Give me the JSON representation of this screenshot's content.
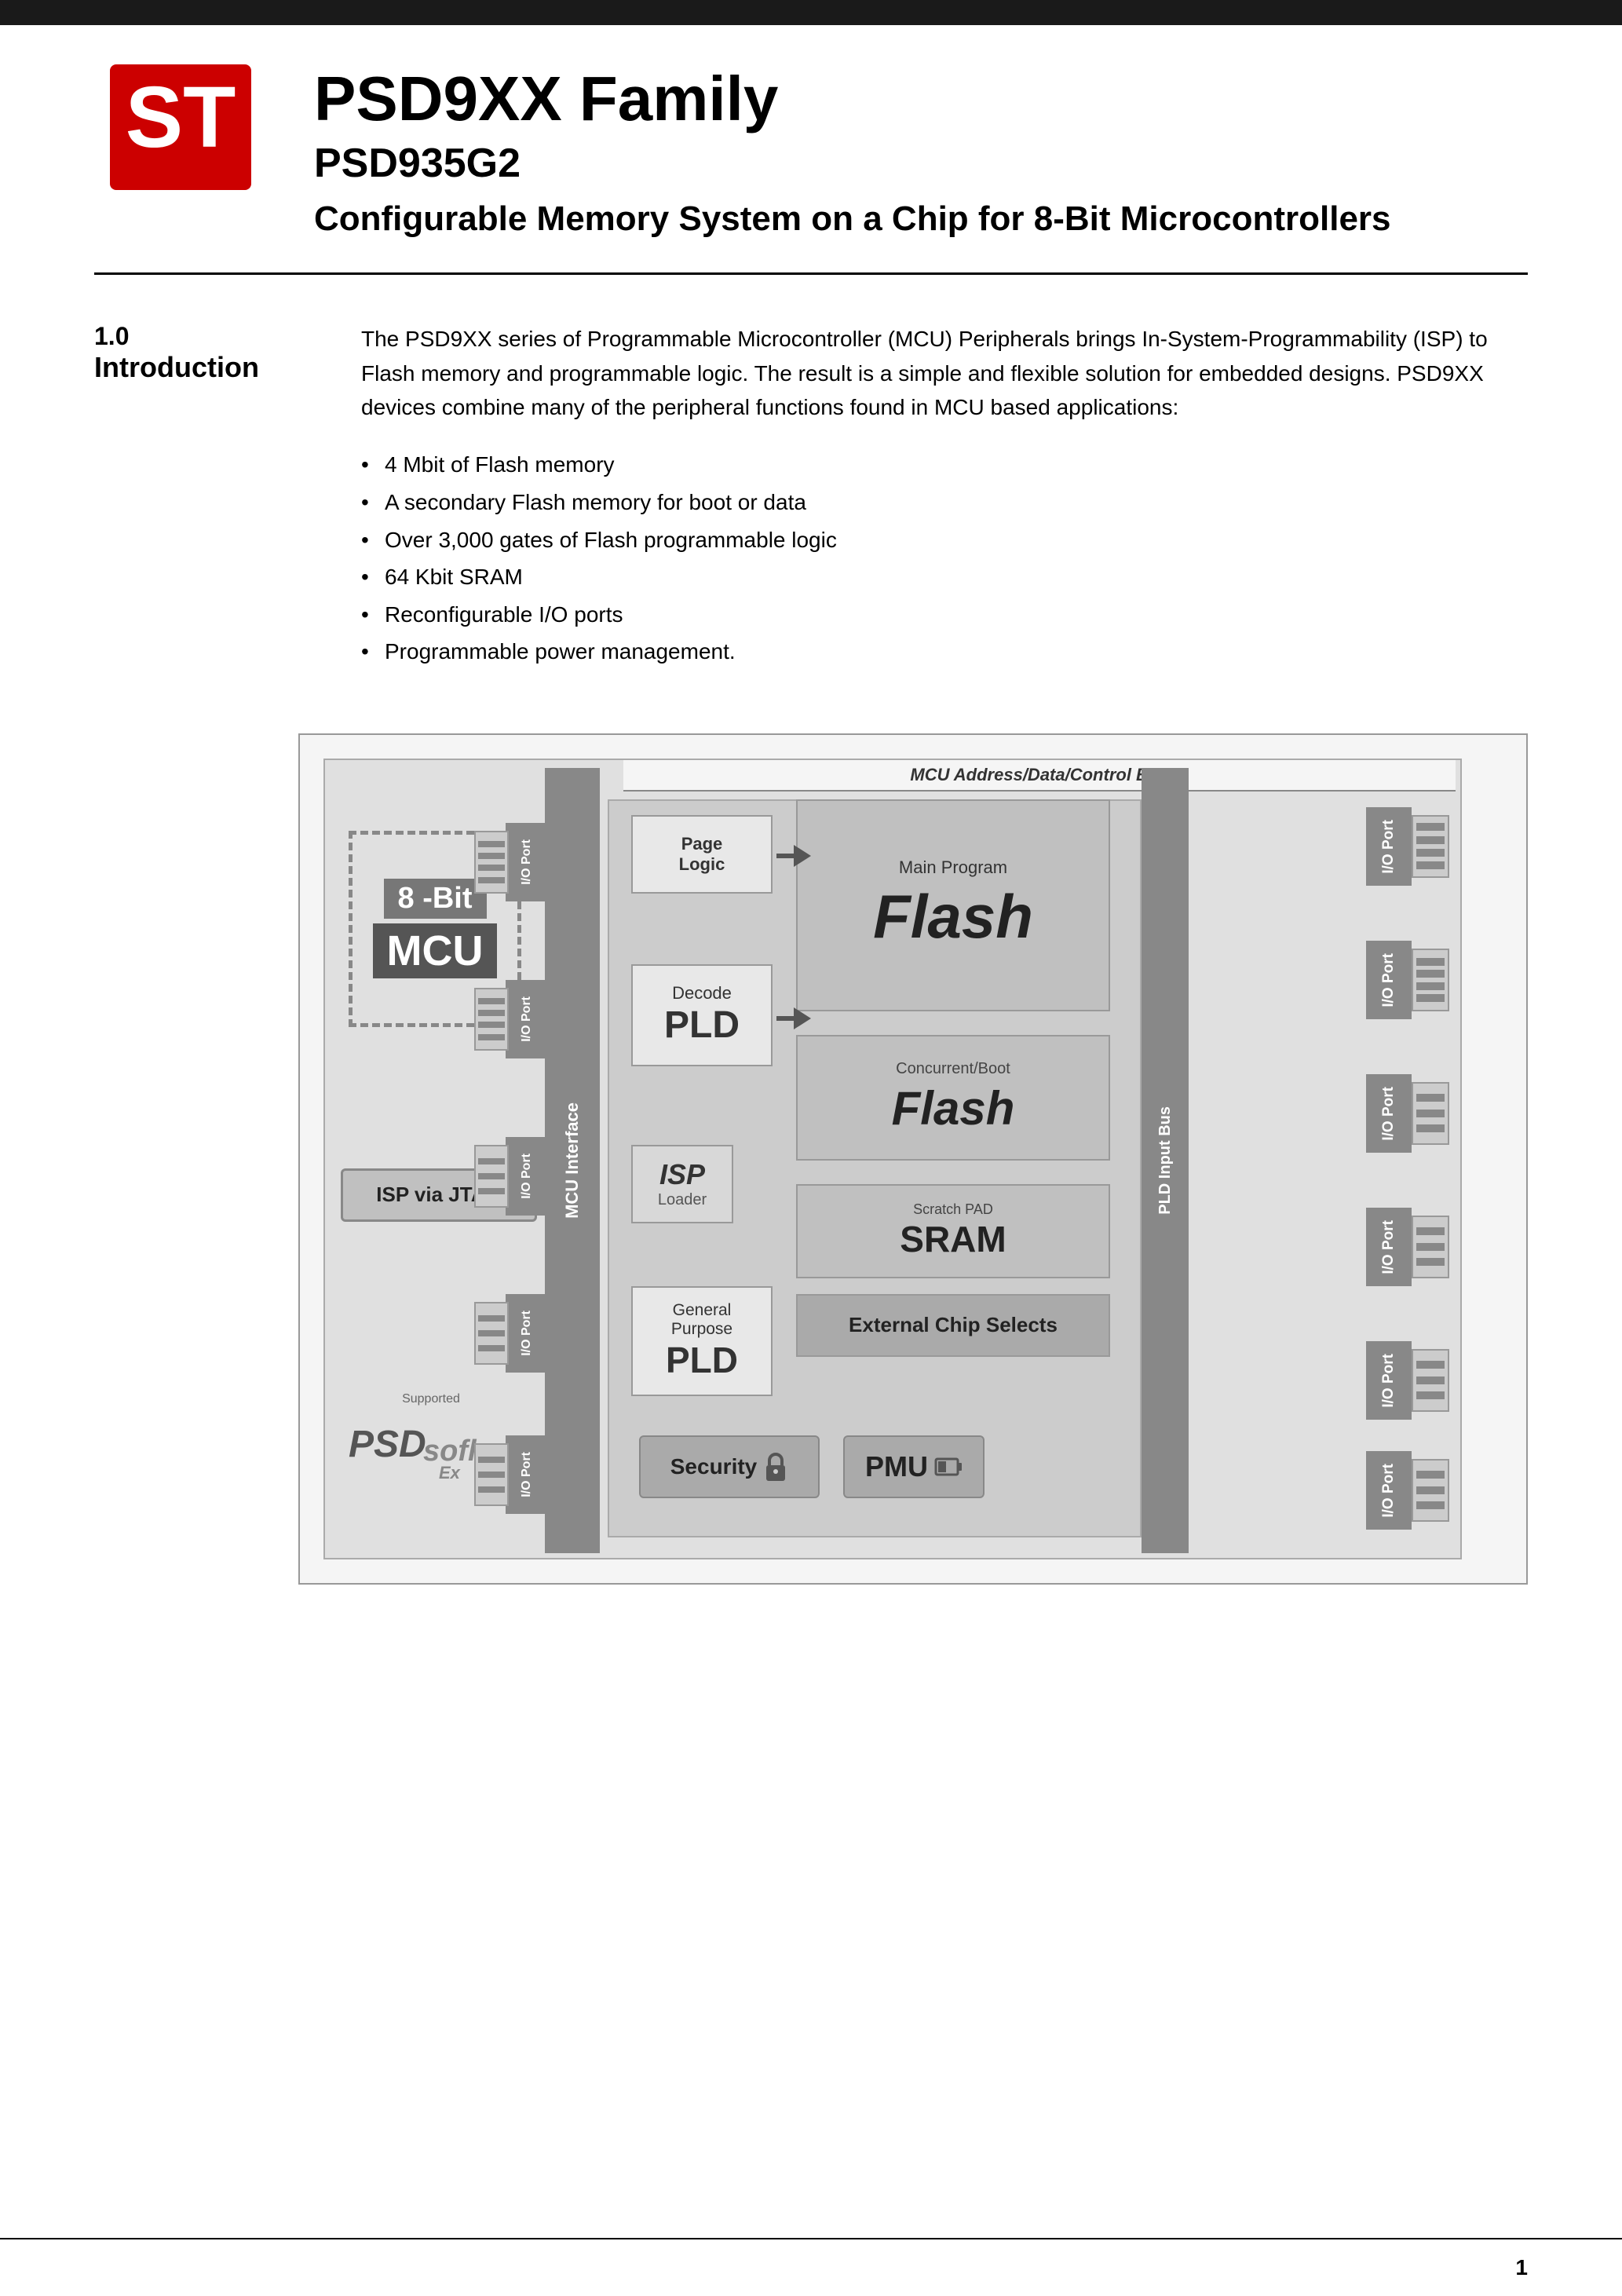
{
  "header": {
    "bar_color": "#1a1a1a",
    "logo_alt": "ST Logo",
    "main_title": "PSD9XX Family",
    "sub_title": "PSD935G2",
    "description": "Configurable Memory System on a Chip for 8-Bit Microcontrollers"
  },
  "section": {
    "number": "1.0",
    "name": "Introduction",
    "intro_text": "The PSD9XX series of Programmable Microcontroller (MCU) Peripherals brings In-System-Programmability (ISP) to Flash memory and programmable logic. The result is a simple and flexible solution for embedded designs. PSD9XX devices combine many of the peripheral functions found in MCU based applications:",
    "bullets": [
      "4 Mbit of Flash memory",
      "A secondary Flash memory for boot or data",
      "Over 3,000 gates of Flash programmable logic",
      "64 Kbit SRAM",
      "Reconfigurable I/O ports",
      "Programmable power management."
    ]
  },
  "diagram": {
    "bus_header": "MCU Address/Data/Control Bus",
    "mcu_8bit": "8 -Bit",
    "mcu_label": "MCU",
    "isp_jtag": "ISP via JTAG",
    "mcu_interface": "MCU Interface",
    "page_logic_line1": "Page",
    "page_logic_line2": "Logic",
    "decode_label": "Decode",
    "pld_label": "PLD",
    "isp_italic": "ISP",
    "loader_label": "Loader",
    "gen_purpose_line1": "General",
    "gen_purpose_line2": "Purpose",
    "pld_label2": "PLD",
    "main_program_label": "Main Program",
    "flash_label": "Flash",
    "concurrent_label": "Concurrent/Boot",
    "boot_flash_label": "Flash",
    "scratch_pad_label": "Scratch PAD",
    "sram_label": "SRAM",
    "ext_chip_selects": "External Chip Selects",
    "security_label": "Security",
    "pmu_label": "PMU",
    "pld_input_bus": "PLD Input Bus",
    "io_port_label": "I/O Port",
    "supported_label": "Supported",
    "psdsoft_label": "PSDsoflex",
    "page_number": "1"
  }
}
